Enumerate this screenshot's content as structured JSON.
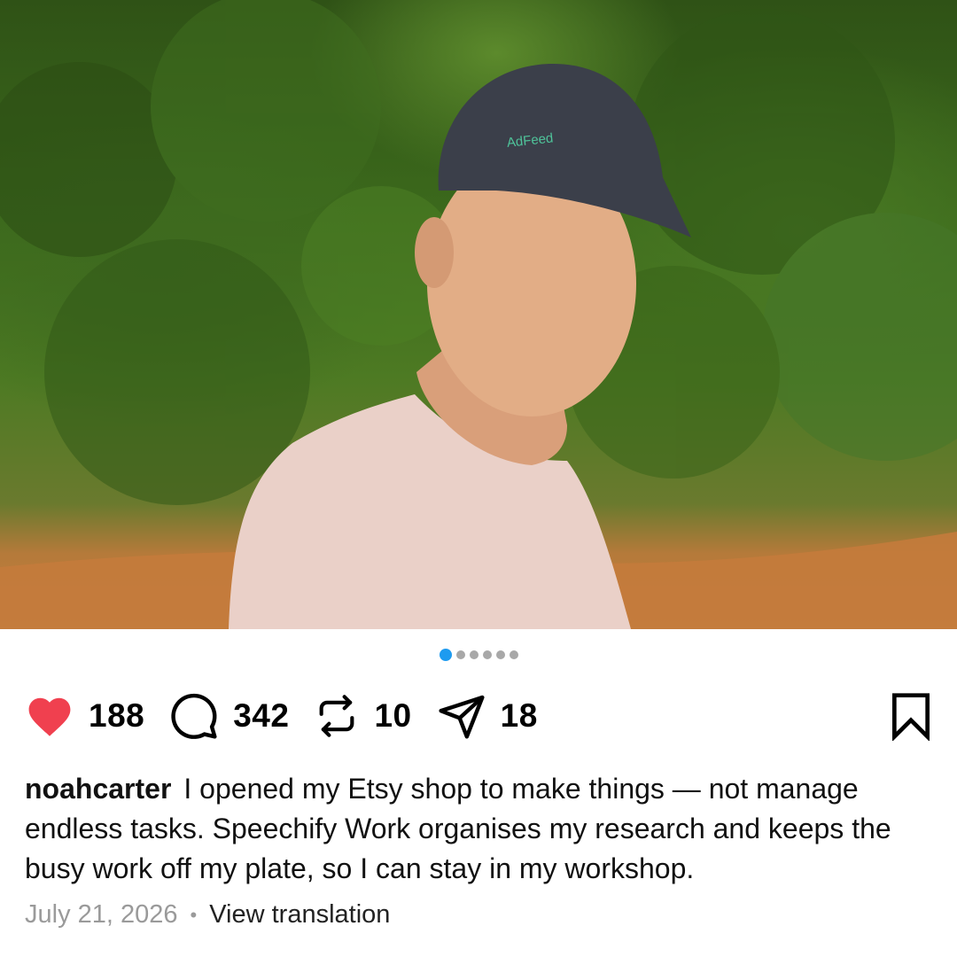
{
  "post": {
    "image": {
      "description_icon": "photo-man-in-cap",
      "cap_logo_text": "AdFeed"
    },
    "carousel": {
      "total": 6,
      "active_index": 0
    },
    "stats": {
      "likes": "188",
      "comments": "342",
      "reposts": "10",
      "shares": "18"
    },
    "icons": {
      "like": "heart-filled-icon",
      "comment": "comment-bubble-icon",
      "repost": "repost-icon",
      "share": "send-icon",
      "bookmark": "bookmark-icon"
    },
    "colors": {
      "like": "#f0404f",
      "active_dot": "#1d9bf0"
    },
    "username": "noahcarter",
    "caption": "I opened my Etsy shop to make things — not manage endless tasks. Speechify Work organises my research and keeps the busy work off my plate, so I can stay in my workshop.",
    "date": "July 21, 2026",
    "separator": "•",
    "view_translation": "View translation"
  }
}
